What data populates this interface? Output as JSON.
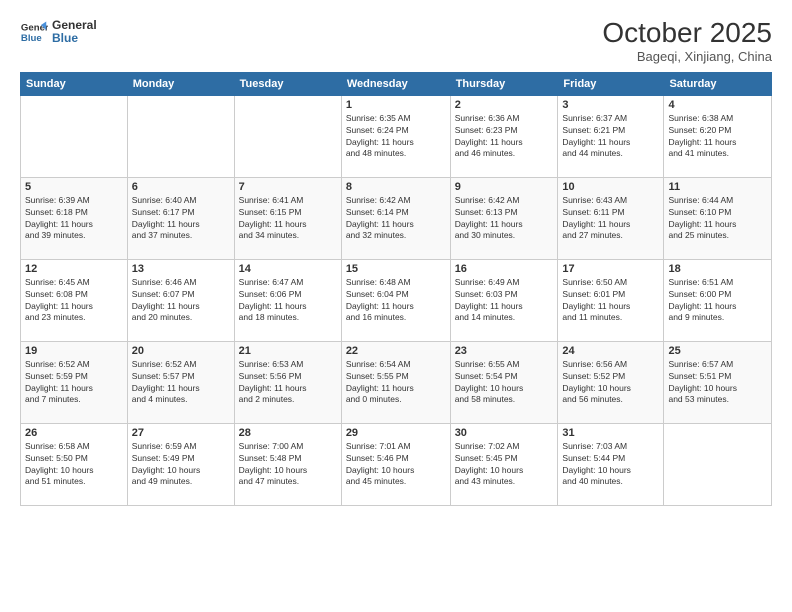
{
  "logo": {
    "line1": "General",
    "line2": "Blue"
  },
  "title": "October 2025",
  "location": "Bageqi, Xinjiang, China",
  "weekdays": [
    "Sunday",
    "Monday",
    "Tuesday",
    "Wednesday",
    "Thursday",
    "Friday",
    "Saturday"
  ],
  "weeks": [
    [
      {
        "day": "",
        "info": ""
      },
      {
        "day": "",
        "info": ""
      },
      {
        "day": "",
        "info": ""
      },
      {
        "day": "1",
        "info": "Sunrise: 6:35 AM\nSunset: 6:24 PM\nDaylight: 11 hours\nand 48 minutes."
      },
      {
        "day": "2",
        "info": "Sunrise: 6:36 AM\nSunset: 6:23 PM\nDaylight: 11 hours\nand 46 minutes."
      },
      {
        "day": "3",
        "info": "Sunrise: 6:37 AM\nSunset: 6:21 PM\nDaylight: 11 hours\nand 44 minutes."
      },
      {
        "day": "4",
        "info": "Sunrise: 6:38 AM\nSunset: 6:20 PM\nDaylight: 11 hours\nand 41 minutes."
      }
    ],
    [
      {
        "day": "5",
        "info": "Sunrise: 6:39 AM\nSunset: 6:18 PM\nDaylight: 11 hours\nand 39 minutes."
      },
      {
        "day": "6",
        "info": "Sunrise: 6:40 AM\nSunset: 6:17 PM\nDaylight: 11 hours\nand 37 minutes."
      },
      {
        "day": "7",
        "info": "Sunrise: 6:41 AM\nSunset: 6:15 PM\nDaylight: 11 hours\nand 34 minutes."
      },
      {
        "day": "8",
        "info": "Sunrise: 6:42 AM\nSunset: 6:14 PM\nDaylight: 11 hours\nand 32 minutes."
      },
      {
        "day": "9",
        "info": "Sunrise: 6:42 AM\nSunset: 6:13 PM\nDaylight: 11 hours\nand 30 minutes."
      },
      {
        "day": "10",
        "info": "Sunrise: 6:43 AM\nSunset: 6:11 PM\nDaylight: 11 hours\nand 27 minutes."
      },
      {
        "day": "11",
        "info": "Sunrise: 6:44 AM\nSunset: 6:10 PM\nDaylight: 11 hours\nand 25 minutes."
      }
    ],
    [
      {
        "day": "12",
        "info": "Sunrise: 6:45 AM\nSunset: 6:08 PM\nDaylight: 11 hours\nand 23 minutes."
      },
      {
        "day": "13",
        "info": "Sunrise: 6:46 AM\nSunset: 6:07 PM\nDaylight: 11 hours\nand 20 minutes."
      },
      {
        "day": "14",
        "info": "Sunrise: 6:47 AM\nSunset: 6:06 PM\nDaylight: 11 hours\nand 18 minutes."
      },
      {
        "day": "15",
        "info": "Sunrise: 6:48 AM\nSunset: 6:04 PM\nDaylight: 11 hours\nand 16 minutes."
      },
      {
        "day": "16",
        "info": "Sunrise: 6:49 AM\nSunset: 6:03 PM\nDaylight: 11 hours\nand 14 minutes."
      },
      {
        "day": "17",
        "info": "Sunrise: 6:50 AM\nSunset: 6:01 PM\nDaylight: 11 hours\nand 11 minutes."
      },
      {
        "day": "18",
        "info": "Sunrise: 6:51 AM\nSunset: 6:00 PM\nDaylight: 11 hours\nand 9 minutes."
      }
    ],
    [
      {
        "day": "19",
        "info": "Sunrise: 6:52 AM\nSunset: 5:59 PM\nDaylight: 11 hours\nand 7 minutes."
      },
      {
        "day": "20",
        "info": "Sunrise: 6:52 AM\nSunset: 5:57 PM\nDaylight: 11 hours\nand 4 minutes."
      },
      {
        "day": "21",
        "info": "Sunrise: 6:53 AM\nSunset: 5:56 PM\nDaylight: 11 hours\nand 2 minutes."
      },
      {
        "day": "22",
        "info": "Sunrise: 6:54 AM\nSunset: 5:55 PM\nDaylight: 11 hours\nand 0 minutes."
      },
      {
        "day": "23",
        "info": "Sunrise: 6:55 AM\nSunset: 5:54 PM\nDaylight: 10 hours\nand 58 minutes."
      },
      {
        "day": "24",
        "info": "Sunrise: 6:56 AM\nSunset: 5:52 PM\nDaylight: 10 hours\nand 56 minutes."
      },
      {
        "day": "25",
        "info": "Sunrise: 6:57 AM\nSunset: 5:51 PM\nDaylight: 10 hours\nand 53 minutes."
      }
    ],
    [
      {
        "day": "26",
        "info": "Sunrise: 6:58 AM\nSunset: 5:50 PM\nDaylight: 10 hours\nand 51 minutes."
      },
      {
        "day": "27",
        "info": "Sunrise: 6:59 AM\nSunset: 5:49 PM\nDaylight: 10 hours\nand 49 minutes."
      },
      {
        "day": "28",
        "info": "Sunrise: 7:00 AM\nSunset: 5:48 PM\nDaylight: 10 hours\nand 47 minutes."
      },
      {
        "day": "29",
        "info": "Sunrise: 7:01 AM\nSunset: 5:46 PM\nDaylight: 10 hours\nand 45 minutes."
      },
      {
        "day": "30",
        "info": "Sunrise: 7:02 AM\nSunset: 5:45 PM\nDaylight: 10 hours\nand 43 minutes."
      },
      {
        "day": "31",
        "info": "Sunrise: 7:03 AM\nSunset: 5:44 PM\nDaylight: 10 hours\nand 40 minutes."
      },
      {
        "day": "",
        "info": ""
      }
    ]
  ]
}
